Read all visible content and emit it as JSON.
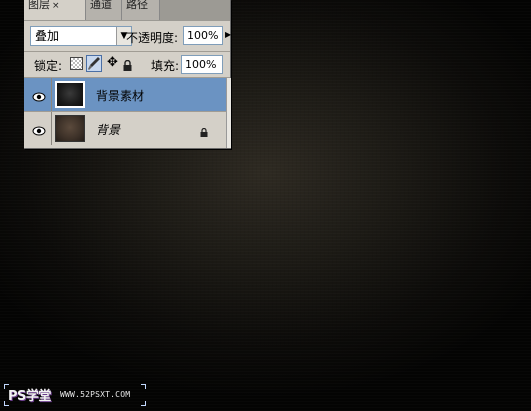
{
  "layers_panel": {
    "tabs": [
      {
        "label": "图层",
        "close": "×"
      },
      {
        "label": "通道"
      },
      {
        "label": "路径"
      }
    ],
    "blend_mode": "叠加",
    "opacity_label": "不透明度:",
    "opacity_value": "100%",
    "lock_label": "锁定:",
    "fill_label": "填充:",
    "fill_value": "100%",
    "layers": [
      {
        "name": "背景素材",
        "selected": true,
        "visible": true
      },
      {
        "name": "背景",
        "selected": false,
        "visible": true,
        "locked": true
      }
    ]
  },
  "watermark": {
    "logo": "PS学堂",
    "url": "WWW.52PSXT.COM"
  },
  "colors": {
    "panel_bg": "#d4d0c8",
    "selected_row": "#6b93c2",
    "canvas_bg": "#1a1814"
  }
}
